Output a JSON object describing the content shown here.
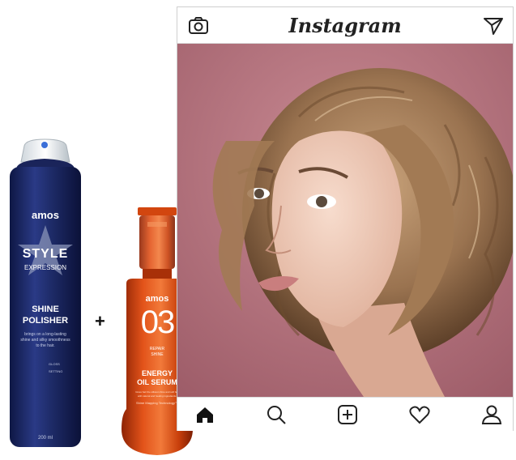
{
  "instagram": {
    "logo_text": "Instagram",
    "header_icons": [
      "camera-icon",
      "direct-message-icon"
    ],
    "nav_icons": [
      "home-icon",
      "search-icon",
      "add-post-icon",
      "heart-icon",
      "profile-icon"
    ]
  },
  "product_1": {
    "brand": "amos",
    "line_1": "STYLE",
    "line_2": "EXPRESSION",
    "name_1": "SHINE",
    "name_2": "POLISHER",
    "desc_1": "brings on a long-lasting",
    "desc_2": "shine and silky smoothness",
    "desc_3": "to the hair.",
    "hold_1": "GLOSS",
    "hold_2": "SETTING",
    "volume": "200 ml"
  },
  "plus_sign": "+",
  "product_2": {
    "brand": "amos",
    "number": "03",
    "sub_1": "REPAIR",
    "sub_2": "SHINE",
    "name_1": "ENERGY",
    "name_2": "OIL SERUM",
    "desc_1": "Gives hair the silkiest shine and soft feel",
    "desc_2": "with natural and healing ingredients.",
    "tech": "Shine Mapping Technology™"
  },
  "colors": {
    "bottle_navy": "#1d2a66",
    "bottle_orange": "#d9480f",
    "photo_bg": "#b9737f",
    "hair": "#9a7350"
  }
}
